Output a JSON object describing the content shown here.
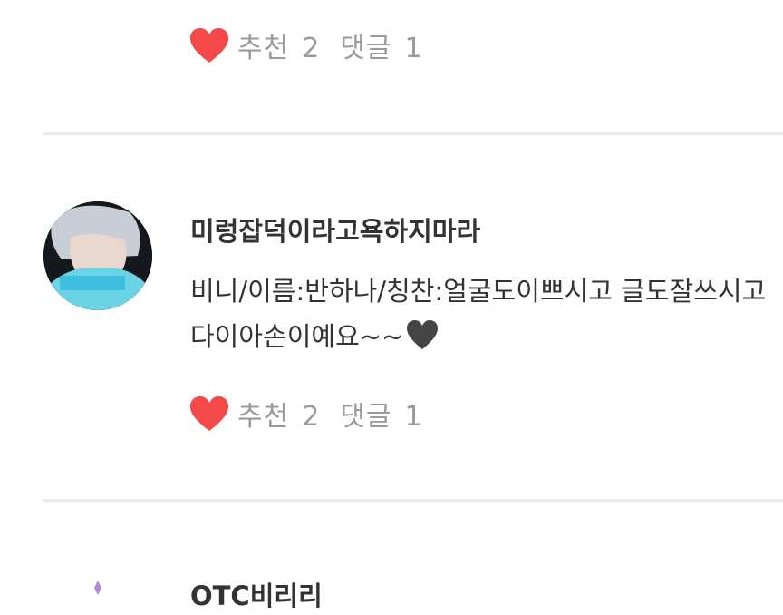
{
  "posts": [
    {
      "recommend_label": "추천",
      "recommend_count": "2",
      "comment_label": "댓글",
      "comment_count": "1"
    },
    {
      "username": "미렁잡덕이라고욕하지마라",
      "content_line1": "비니/이름:반하나/칭찬:얼굴도이쁘시고 글도잘쓰시고",
      "content_line2": "다이아손이예요~~",
      "recommend_label": "추천",
      "recommend_count": "2",
      "comment_label": "댓글",
      "comment_count": "1"
    },
    {
      "username": "ОТС비리리"
    }
  ],
  "colors": {
    "heart": "#f44949",
    "dark_heart": "#444444",
    "divider": "#e9e9e9",
    "muted_text": "#9a9a9a",
    "text": "#333333"
  },
  "icons": {
    "recommend": "heart-icon",
    "emoji": "black-heart-emoji"
  }
}
